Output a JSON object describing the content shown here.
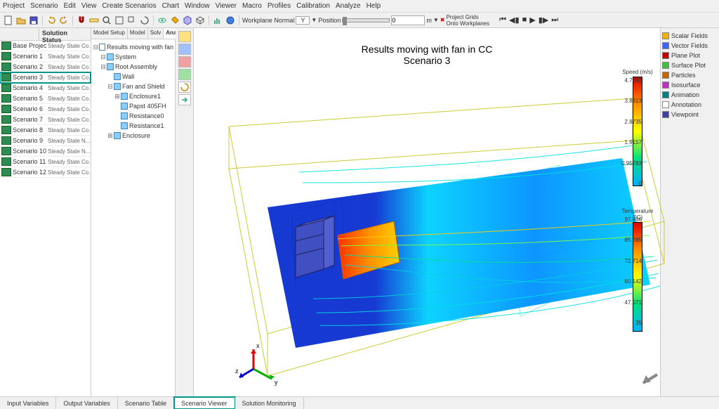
{
  "menu": [
    "Project",
    "Scenario",
    "Edit",
    "View",
    "Create Scenarios",
    "Chart",
    "Window",
    "Viewer",
    "Macro",
    "Profiles",
    "Calibration",
    "Analyze",
    "Help"
  ],
  "toolbar": {
    "workplane_label": "Workplane Normal",
    "workplane_axis": "Y",
    "position_label": "Position",
    "position_value": "0",
    "position_unit": "m",
    "grids_label": "Project Grids\nOnto Workplanes"
  },
  "scenario_panel": {
    "header_name": "",
    "header_status": "Solution Status",
    "rows": [
      {
        "name": "Base Project",
        "status": "Steady State Co..."
      },
      {
        "name": "Scenario 1",
        "status": "Steady State Co..."
      },
      {
        "name": "Scenario 2",
        "status": "Steady State Co..."
      },
      {
        "name": "Scenario 3",
        "status": "Steady State Co..."
      },
      {
        "name": "Scenario 4",
        "status": "Steady State Co..."
      },
      {
        "name": "Scenario 5",
        "status": "Steady State Co..."
      },
      {
        "name": "Scenario 6",
        "status": "Steady State Co..."
      },
      {
        "name": "Scenario 7",
        "status": "Steady State Co..."
      },
      {
        "name": "Scenario 8",
        "status": "Steady State Co..."
      },
      {
        "name": "Scenario 9",
        "status": "Steady State N..."
      },
      {
        "name": "Scenario 10",
        "status": "Steady State N..."
      },
      {
        "name": "Scenario 11",
        "status": "Steady State Co..."
      },
      {
        "name": "Scenario 12",
        "status": "Steady State Co..."
      }
    ],
    "selected_index": 3
  },
  "tree": {
    "tabs": [
      "Model Setup",
      "Model",
      "Solv",
      "Analyze"
    ],
    "active_tab": 3,
    "root": "Results moving with fan i...",
    "items": [
      {
        "depth": 1,
        "exp": "⊟",
        "label": "System"
      },
      {
        "depth": 1,
        "exp": "⊟",
        "label": "Root Assembly"
      },
      {
        "depth": 2,
        "exp": "",
        "label": "Wall"
      },
      {
        "depth": 2,
        "exp": "⊟",
        "label": "Fan and Shield"
      },
      {
        "depth": 3,
        "exp": "⊞",
        "label": "Enclosure1"
      },
      {
        "depth": 3,
        "exp": "",
        "label": "Papst 405FH"
      },
      {
        "depth": 3,
        "exp": "",
        "label": "Resistance0"
      },
      {
        "depth": 3,
        "exp": "",
        "label": "Resistance1"
      },
      {
        "depth": 2,
        "exp": "⊞",
        "label": "Enclosure"
      }
    ]
  },
  "viewer": {
    "title_line1": "Results moving with fan in CC",
    "title_line2": "Scenario 3"
  },
  "legend_speed": {
    "title": "Speed (m/s)",
    "values": [
      "4.7892",
      "3.8313",
      "2.8735",
      "1.9157",
      "0.95783",
      "0"
    ]
  },
  "legend_temp": {
    "title": "Temperature (°C)",
    "values": [
      "97.856",
      "85.285",
      "72.714",
      "60.142",
      "47.571",
      "35"
    ]
  },
  "right_panel": {
    "items": [
      "Scalar Fields",
      "Vector Fields",
      "Plane Plot",
      "Surface Plot",
      "Particles",
      "Isosurface",
      "Animation",
      "Annotation",
      "Viewpoint"
    ]
  },
  "bottom_tabs": {
    "items": [
      "Input Variables",
      "Output Variables",
      "Scenario Table",
      "Scenario Viewer",
      "Solution Monitoring"
    ],
    "active_index": 3
  },
  "icon_colors": {
    "scalar": "#f0b000",
    "vector": "#4060ff",
    "plane": "#c00000",
    "surface": "#40c040",
    "particles": "#c86400",
    "iso": "#c030c0",
    "anim": "#008080",
    "annot": "#806000",
    "view": "#4040a0"
  }
}
